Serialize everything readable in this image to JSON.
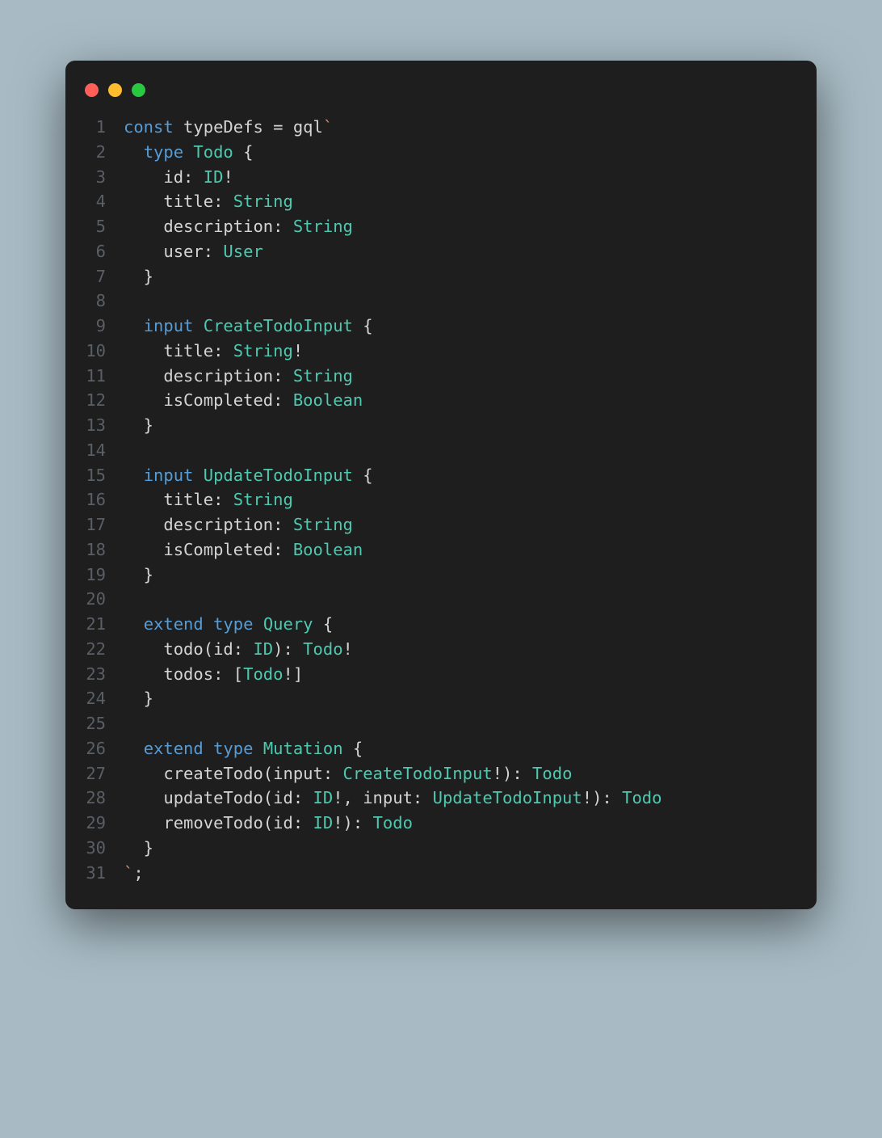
{
  "window": {
    "dots": [
      "red",
      "yellow",
      "green"
    ]
  },
  "code": {
    "lines": [
      {
        "n": "1",
        "tokens": [
          [
            "kw",
            "const"
          ],
          [
            "",
            ", "
          ],
          [
            "",
            "typeDefs "
          ],
          [
            "op",
            "= "
          ],
          [
            "fn",
            "gql"
          ],
          [
            "str",
            "`"
          ]
        ],
        "raw": true
      },
      {
        "n": "1",
        "html": "<span class='kw'>const</span> typeDefs <span class='op'>=</span> gql<span class='str'>`</span>"
      },
      {
        "n": "2",
        "html": "  <span class='kw'>type</span> <span class='type'>Todo</span> {"
      },
      {
        "n": "3",
        "html": "    id: <span class='type'>ID</span>!"
      },
      {
        "n": "4",
        "html": "    title: <span class='type'>String</span>"
      },
      {
        "n": "5",
        "html": "    description: <span class='type'>String</span>"
      },
      {
        "n": "6",
        "html": "    user: <span class='type'>User</span>"
      },
      {
        "n": "7",
        "html": "  }"
      },
      {
        "n": "8",
        "html": ""
      },
      {
        "n": "9",
        "html": "  <span class='kw'>input</span> <span class='type'>CreateTodoInput</span> {"
      },
      {
        "n": "10",
        "html": "    title: <span class='type'>String</span>!"
      },
      {
        "n": "11",
        "html": "    description: <span class='type'>String</span>"
      },
      {
        "n": "12",
        "html": "    isCompleted: <span class='type'>Boolean</span>"
      },
      {
        "n": "13",
        "html": "  }"
      },
      {
        "n": "14",
        "html": ""
      },
      {
        "n": "15",
        "html": "  <span class='kw'>input</span> <span class='type'>UpdateTodoInput</span> {"
      },
      {
        "n": "16",
        "html": "    title: <span class='type'>String</span>"
      },
      {
        "n": "17",
        "html": "    description: <span class='type'>String</span>"
      },
      {
        "n": "18",
        "html": "    isCompleted: <span class='type'>Boolean</span>"
      },
      {
        "n": "19",
        "html": "  }"
      },
      {
        "n": "20",
        "html": ""
      },
      {
        "n": "21",
        "html": "  <span class='kw'>extend</span> <span class='kw'>type</span> <span class='type'>Query</span> {"
      },
      {
        "n": "22",
        "html": "    todo(id: <span class='type'>ID</span>): <span class='type'>Todo</span>!"
      },
      {
        "n": "23",
        "html": "    todos: [<span class='type'>Todo</span>!]"
      },
      {
        "n": "24",
        "html": "  }"
      },
      {
        "n": "25",
        "html": ""
      },
      {
        "n": "26",
        "html": "  <span class='kw'>extend</span> <span class='kw'>type</span> <span class='type'>Mutation</span> {"
      },
      {
        "n": "27",
        "html": "    createTodo(input: <span class='type'>CreateTodoInput</span>!): <span class='type'>Todo</span>"
      },
      {
        "n": "28",
        "html": "    updateTodo(id: <span class='type'>ID</span>!, input: <span class='type'>UpdateTodoInput</span>!): <span class='type'>Todo</span>"
      },
      {
        "n": "29",
        "html": "    removeTodo(id: <span class='type'>ID</span>!): <span class='type'>Todo</span>"
      },
      {
        "n": "30",
        "html": "  }"
      },
      {
        "n": "31",
        "html": "<span class='str'>`</span>;"
      }
    ]
  },
  "colors": {
    "background_page": "#a8bbc4",
    "background_window": "#1e1e1e",
    "keyword": "#569cd6",
    "type": "#4ec9b0",
    "default": "#d4d4d4",
    "linenum": "#5a5f66",
    "string": "#ce9178"
  }
}
